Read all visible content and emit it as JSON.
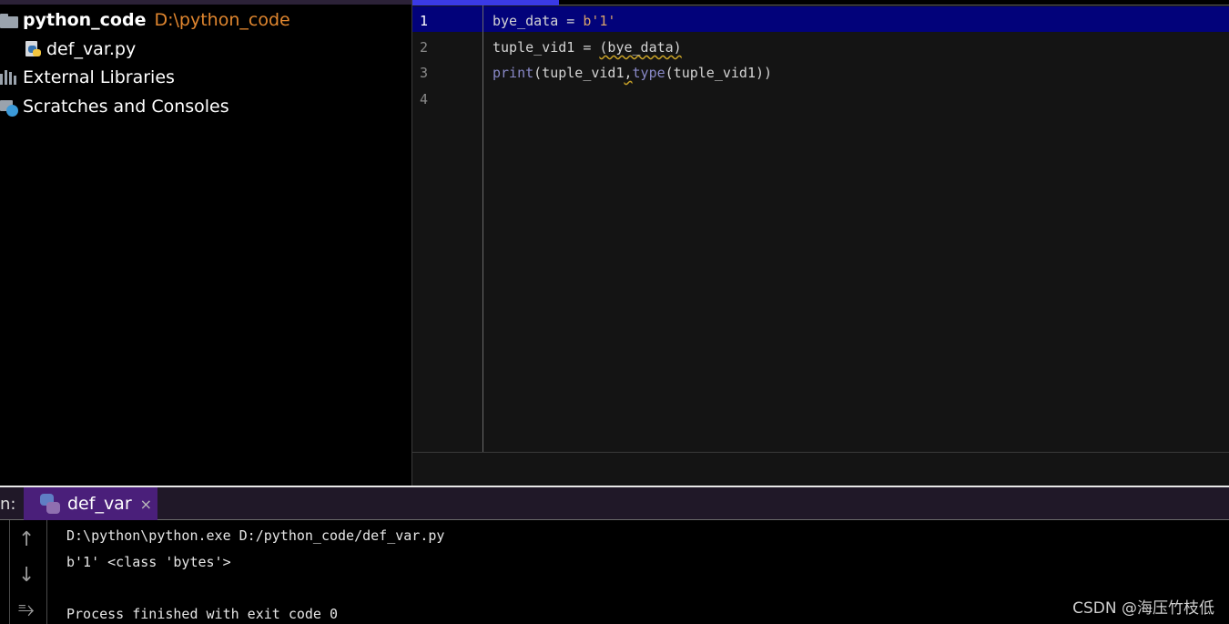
{
  "project": {
    "name": "python_code",
    "path": "D:\\python_code",
    "file": "def_var.py",
    "external_libraries": "External Libraries",
    "scratches": "Scratches and Consoles"
  },
  "editor": {
    "line_numbers": [
      "1",
      "2",
      "3",
      "4"
    ],
    "lines": {
      "l1_var": "bye_data",
      "l1_eq": " = ",
      "l1_str": "b'1'",
      "l2_var": "tuple_vid1 = ",
      "l2_expr": "(bye_data)",
      "l3_print": "print",
      "l3_open": "(tuple_vid1",
      "l3_comma": ",",
      "l3_type": "type",
      "l3_rest": "(tuple_vid1))"
    }
  },
  "run": {
    "label": "n:",
    "tab_name": "def_var",
    "close": "×",
    "buttons": {
      "up": "↑",
      "down": "↓",
      "wrap": "⥱"
    },
    "output": [
      "D:\\python\\python.exe D:/python_code/def_var.py",
      "b'1' <class 'bytes'>",
      "",
      "Process finished with exit code 0"
    ]
  },
  "watermark": "CSDN @海压竹枝低",
  "icons": [
    "folder-icon",
    "python-file-icon",
    "library-icon",
    "scratches-icon",
    "python-icon",
    "close-icon",
    "arrow-up-icon",
    "arrow-down-icon",
    "soft-wrap-icon"
  ]
}
